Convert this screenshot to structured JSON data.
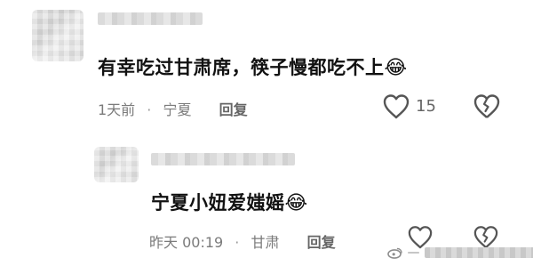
{
  "comments": [
    {
      "text": "有幸吃过甘肃席，筷子慢都吃不上",
      "emoji": "😂",
      "time": "1天前",
      "location": "宁夏",
      "reply_label": "回复",
      "likes": "15"
    },
    {
      "text": "宁夏小妞爱媸媱",
      "emoji": "😂",
      "time": "昨天 00:19",
      "location": "甘肃",
      "reply_label": "回复",
      "likes": ""
    }
  ],
  "watermark": {
    "text": "—"
  },
  "icons": {
    "like": "heart-outline-icon",
    "dislike": "broken-heart-icon",
    "weibo": "weibo-logo-icon"
  },
  "colors": {
    "text": "#111111",
    "meta": "#7b7b7b",
    "icon": "#555555"
  }
}
